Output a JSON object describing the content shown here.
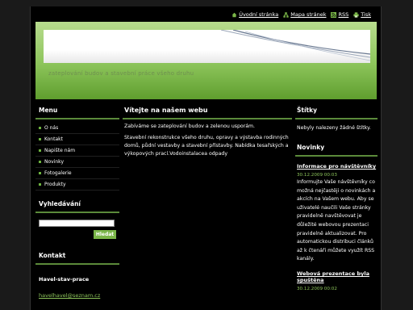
{
  "topnav": {
    "items": [
      {
        "label": "Úvodní stránka",
        "icon": "home-icon"
      },
      {
        "label": "Mapa stránek",
        "icon": "sitemap-icon"
      },
      {
        "label": "RSS",
        "icon": "rss-icon"
      },
      {
        "label": "Tisk",
        "icon": "print-icon"
      }
    ]
  },
  "header": {
    "tagline": "zateplování budov a stavební práce všeho druhu"
  },
  "menu": {
    "title": "Menu",
    "items": [
      "O nás",
      "Kontakt",
      "Napište nám",
      "Novinky",
      "Fotogalerie",
      "Produkty"
    ]
  },
  "search": {
    "title": "Vyhledávání",
    "placeholder": "",
    "value": "",
    "button": "Hledat"
  },
  "contact": {
    "title": "Kontakt",
    "name": "Havel-stav-prace",
    "email": "havelhavel@seznam.cz"
  },
  "main": {
    "title": "Vítejte na našem webu",
    "paragraph1": "Zabíváme se zateplování budov a zelenou usporám.",
    "paragraph2": "Stavební rekonstrukce všeho druhu, opravy a výstavba rodinných domů, půdní vestavby a stavební přístavby. Nabídka tesařských a výkopových prací.Vodoinstalacea odpady"
  },
  "tags": {
    "title": "Štítky",
    "text": "Nebyly nalezeny žádné štítky."
  },
  "news": {
    "title": "Novinky",
    "items": [
      {
        "title": "Informace pro návštěvníky",
        "date": "30.12.2009 00:03",
        "text": "Informujte Vaše návštěvníky co možná nejčastěji o novinkách a akcích na Vašem webu. Aby se uživatelé naučili Vaše stránky pravidelně navštěvovat je důležité webovou prezentaci pravidelně aktualizovat. Pro automatickou distribuci článků až k čtenáři můžete využít RSS kanály."
      },
      {
        "title": "Webová prezentace byla spuštěna",
        "date": "30.12.2009 00:02"
      }
    ]
  },
  "colors": {
    "accent": "#7ab648",
    "background": "#000000",
    "link": "#8cc45a"
  }
}
